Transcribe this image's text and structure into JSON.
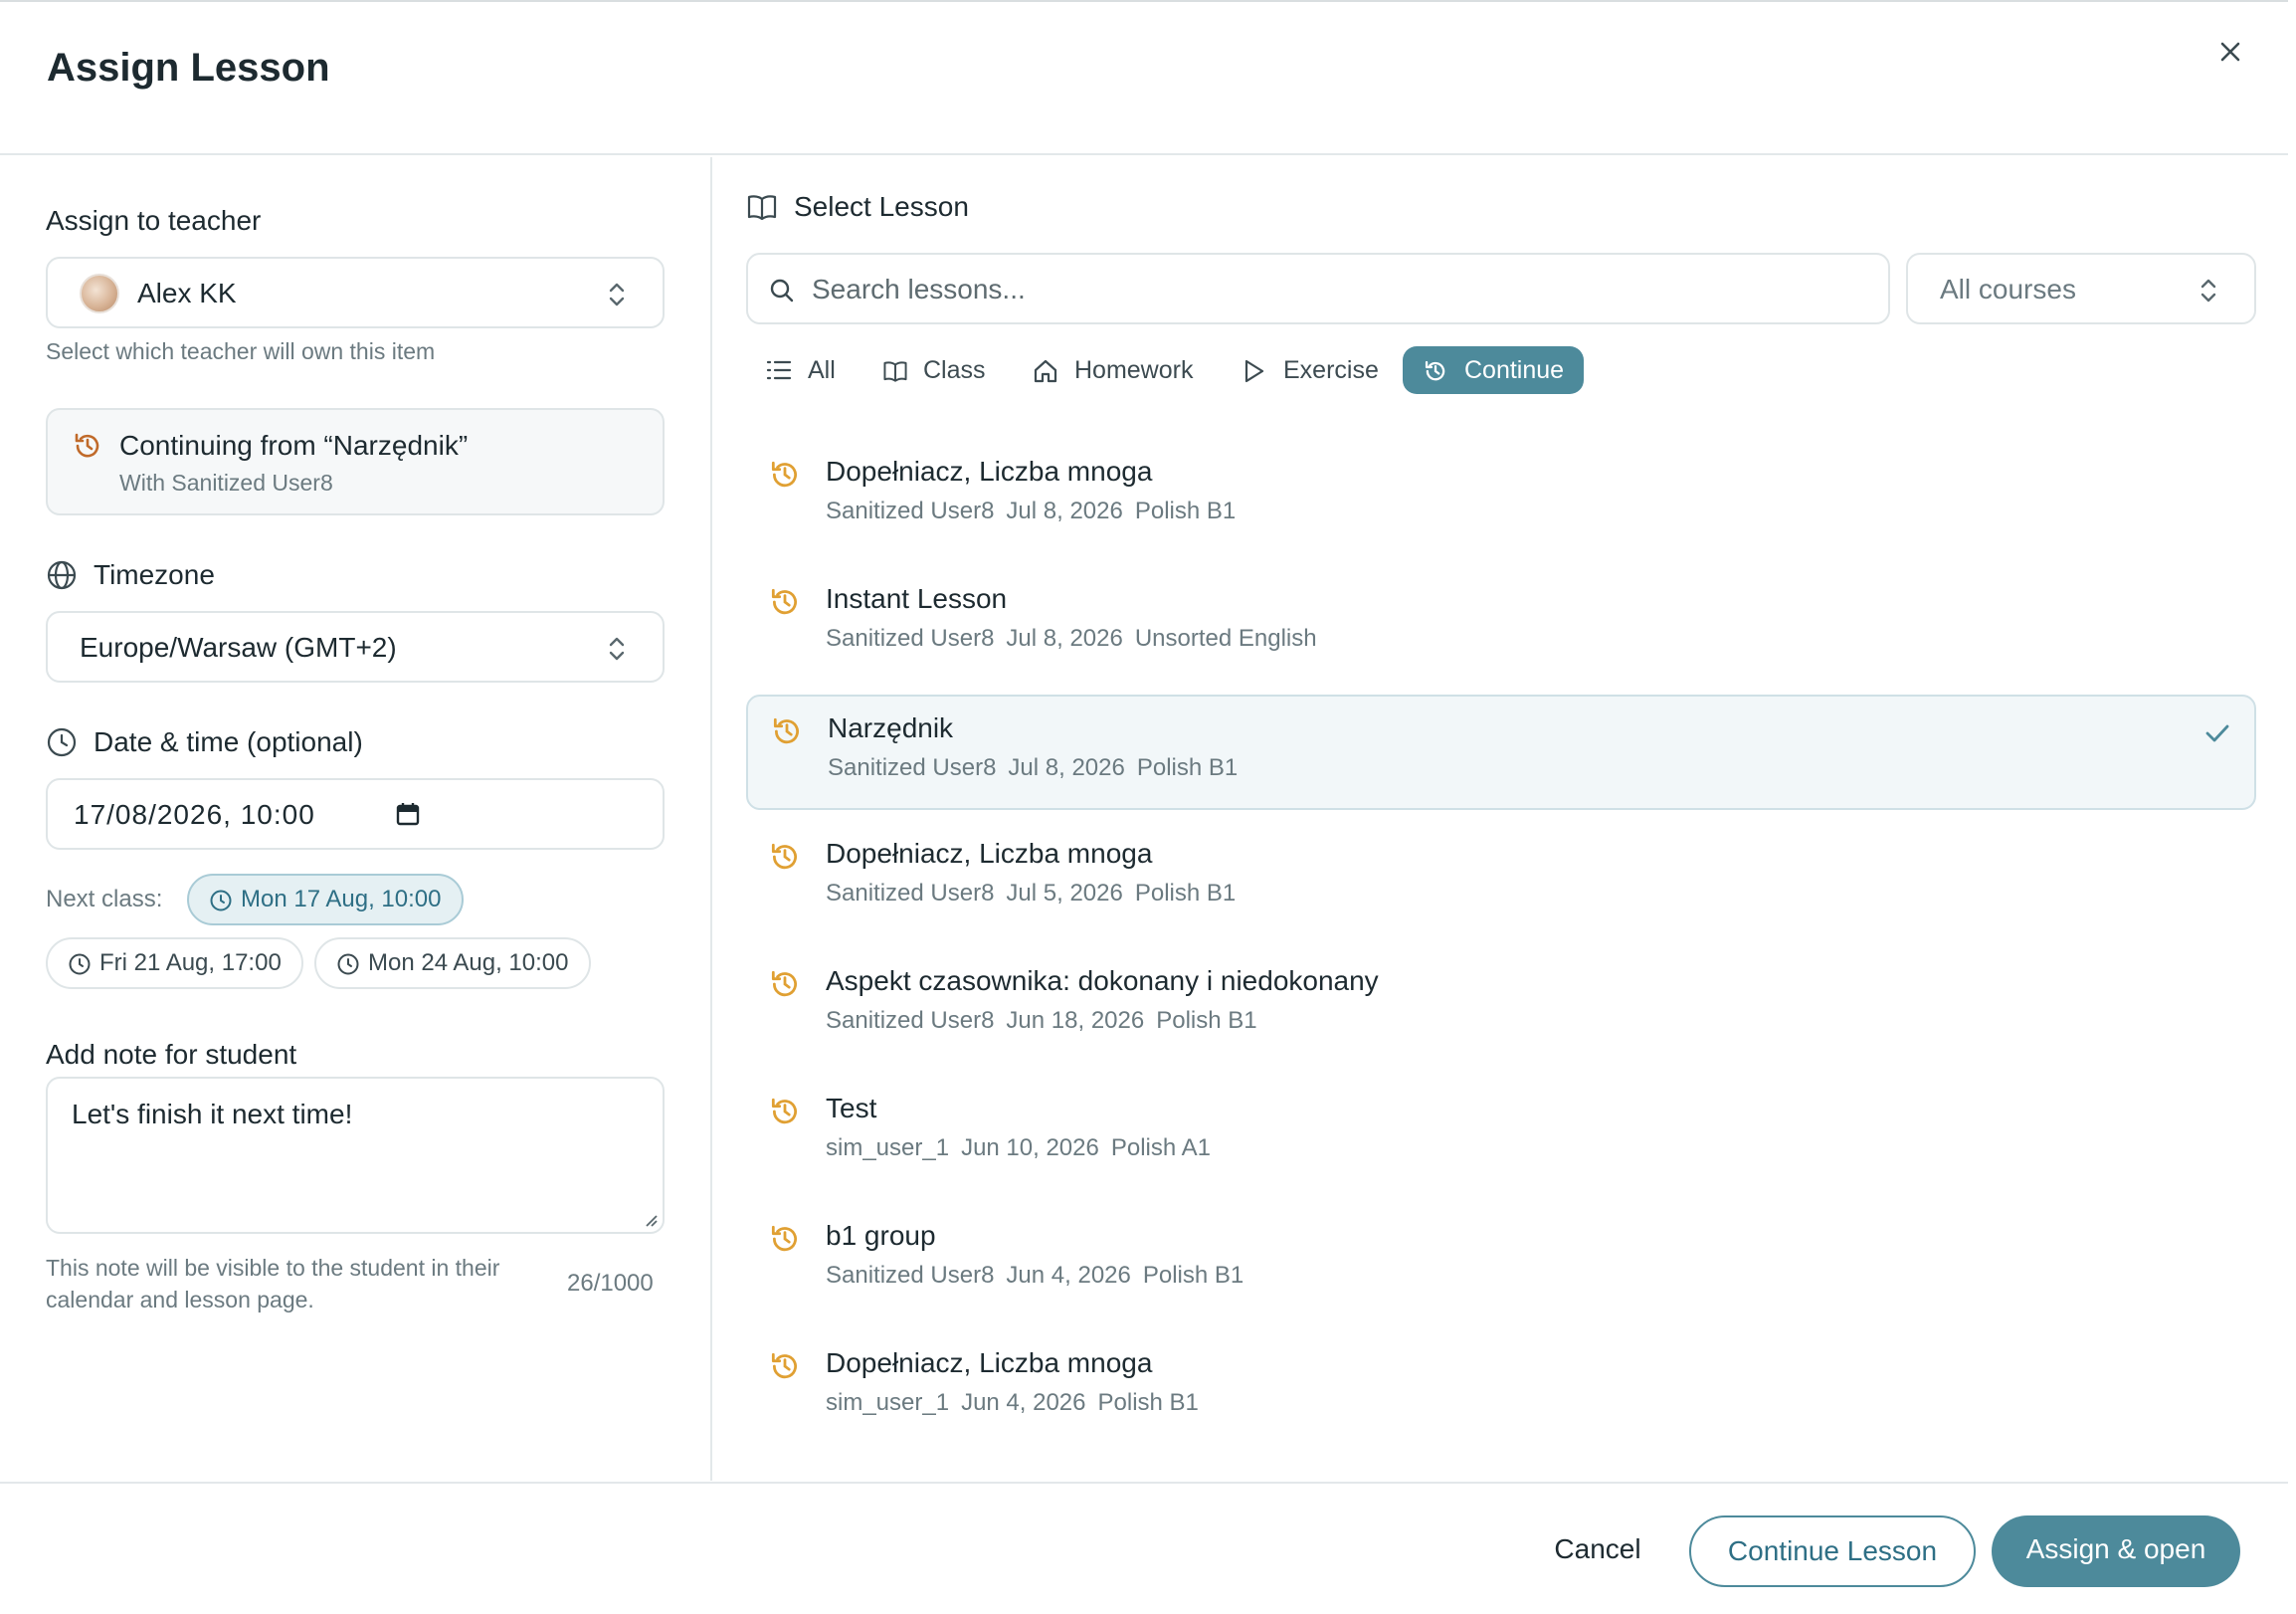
{
  "dialog": {
    "title": "Assign Lesson"
  },
  "left": {
    "teacher": {
      "label": "Assign to teacher",
      "value": "Alex KK",
      "hint": "Select which teacher will own this item"
    },
    "continuing": {
      "title": "Continuing from “Narzędnik”",
      "subtitle": "With Sanitized User8"
    },
    "timezone": {
      "label": "Timezone",
      "value": "Europe/Warsaw (GMT+2)"
    },
    "datetime": {
      "label": "Date & time (optional)",
      "value": "17/08/2026, 10:00",
      "next_class_label": "Next class:",
      "chips": [
        "Mon 17 Aug, 10:00",
        "Fri 21 Aug, 17:00",
        "Mon 24 Aug, 10:00"
      ]
    },
    "note": {
      "label": "Add note for student",
      "value": "Let's finish it next time!",
      "hint": "This note will be visible to the student in their calendar and lesson page.",
      "counter": "26/1000"
    }
  },
  "right": {
    "header": "Select Lesson",
    "search_placeholder": "Search lessons...",
    "course_select": "All courses",
    "filters": [
      "All",
      "Class",
      "Homework",
      "Exercise",
      "Continue"
    ],
    "active_filter": "Continue",
    "lessons": [
      {
        "title": "Dopełniacz, Liczba mnoga",
        "user": "Sanitized User8",
        "date": "Jul 8, 2026",
        "course": "Polish B1"
      },
      {
        "title": "Instant Lesson",
        "user": "Sanitized User8",
        "date": "Jul 8, 2026",
        "course": "Unsorted English"
      },
      {
        "title": "Narzędnik",
        "user": "Sanitized User8",
        "date": "Jul 8, 2026",
        "course": "Polish B1",
        "selected": true
      },
      {
        "title": "Dopełniacz, Liczba mnoga",
        "user": "Sanitized User8",
        "date": "Jul 5, 2026",
        "course": "Polish B1"
      },
      {
        "title": "Aspekt czasownika: dokonany i niedokonany",
        "user": "Sanitized User8",
        "date": "Jun 18, 2026",
        "course": "Polish B1"
      },
      {
        "title": "Test",
        "user": "sim_user_1",
        "date": "Jun 10, 2026",
        "course": "Polish A1"
      },
      {
        "title": "b1 group",
        "user": "Sanitized User8",
        "date": "Jun 4, 2026",
        "course": "Polish B1"
      },
      {
        "title": "Dopełniacz, Liczba mnoga",
        "user": "sim_user_1",
        "date": "Jun 4, 2026",
        "course": "Polish B1"
      }
    ]
  },
  "footer": {
    "cancel": "Cancel",
    "continue": "Continue Lesson",
    "assign": "Assign & open"
  },
  "colors": {
    "accent": "#4d8a9b",
    "history_icon": "#e0a033",
    "selected_bg": "#f2f7f9"
  }
}
